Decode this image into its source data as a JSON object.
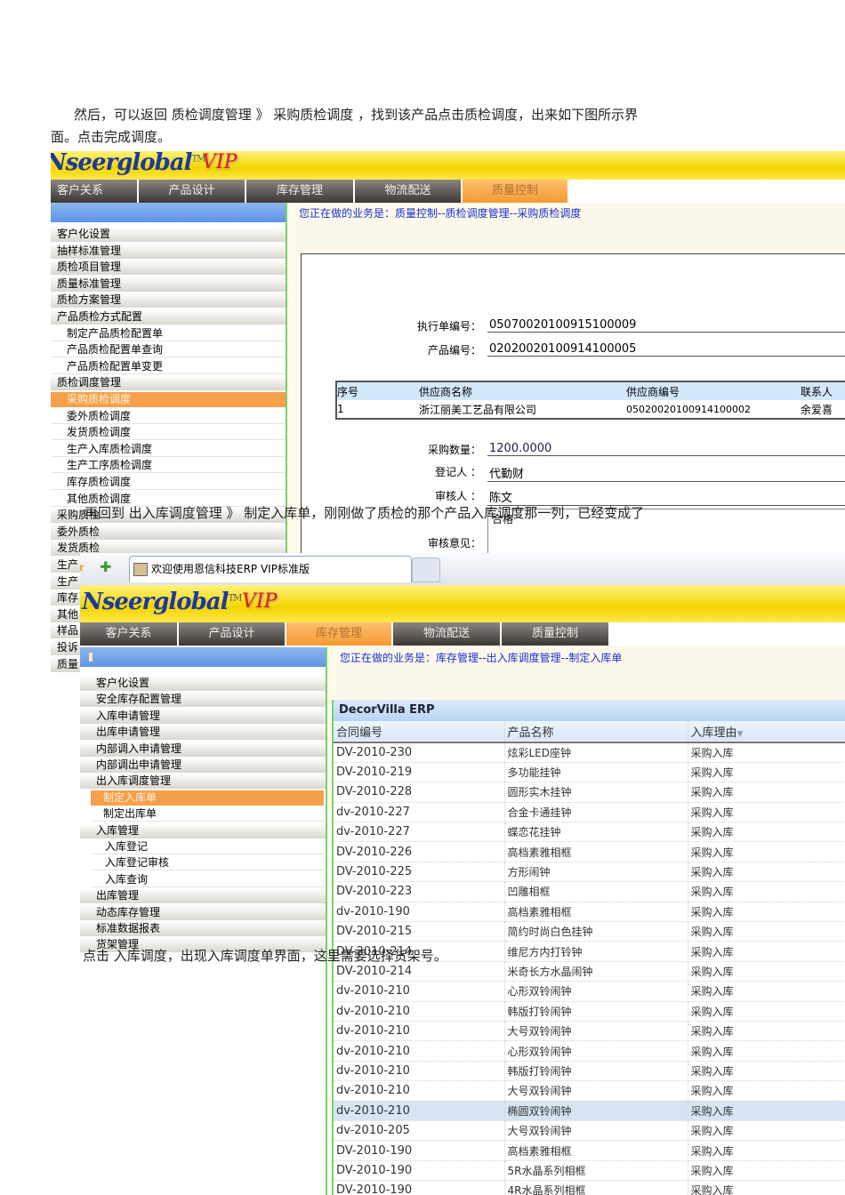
{
  "doc": {
    "para1_line1": "然后，可以返回 质检调度管理  》 采购质检调度 ，找到该产品点击质检调度，出来如下图所示界",
    "para1_line2": "面。点击完成调度。",
    "para2": "再回到  出入库调度管理 》 制定入库单，刚刚做了质检的那个产品入库调度那一列，已经变成了",
    "para3": "点击 入库调度，出现入库调度单界面，这里需要选择货架号。"
  },
  "shot1": {
    "logo": "Nseerglobal",
    "tm": "TM",
    "vip": "VIP",
    "nav": [
      "客户关系",
      "产品设计",
      "库存管理",
      "物流配送",
      "质量控制"
    ],
    "active_nav": 4,
    "crumb": "您正在做的业务是：质量控制--质检调度管理--采购质检调度",
    "sidebar": [
      {
        "label": "客户化设置",
        "type": "group"
      },
      {
        "label": "抽样标准管理",
        "type": "group"
      },
      {
        "label": "质检项目管理",
        "type": "group"
      },
      {
        "label": "质量标准管理",
        "type": "group"
      },
      {
        "label": "质检方案管理",
        "type": "group"
      },
      {
        "label": "产品质检方式配置",
        "type": "group"
      },
      {
        "label": "制定产品质检配置单",
        "type": "sub"
      },
      {
        "label": "产品质检配置单查询",
        "type": "sub"
      },
      {
        "label": "产品质检配置单变更",
        "type": "sub"
      },
      {
        "label": "质检调度管理",
        "type": "group"
      },
      {
        "label": "采购质检调度",
        "type": "sel"
      },
      {
        "label": "委外质检调度",
        "type": "sub"
      },
      {
        "label": "发货质检调度",
        "type": "sub"
      },
      {
        "label": "生产入库质检调度",
        "type": "sub"
      },
      {
        "label": "生产工序质检调度",
        "type": "sub"
      },
      {
        "label": "库存质检调度",
        "type": "sub"
      },
      {
        "label": "其他质检调度",
        "type": "sub"
      },
      {
        "label": "采购质检",
        "type": "group"
      },
      {
        "label": "委外质检",
        "type": "group"
      },
      {
        "label": "发货质检",
        "type": "group"
      },
      {
        "label": "生产",
        "type": "group"
      },
      {
        "label": "生产",
        "type": "group"
      },
      {
        "label": "库存",
        "type": "group"
      },
      {
        "label": "其他",
        "type": "group"
      },
      {
        "label": "样品",
        "type": "group"
      },
      {
        "label": "投诉",
        "type": "group"
      },
      {
        "label": "质量",
        "type": "group"
      }
    ],
    "form": {
      "exec_no_label": "执行单编号：",
      "exec_no": "05070020100915100009",
      "product_no_label": "产品编号：",
      "product_no": "02020020100914100005",
      "qty_label": "采购数量：",
      "qty": "1200.0000",
      "registrar_label": "登记人  ：",
      "registrar": "代勤财",
      "reviewer_label": "审核人  ：",
      "reviewer": "陈文",
      "opinion_label": "审核意见：",
      "opinion": "合格"
    },
    "supplier_table": {
      "headers": [
        "序号",
        "供应商名称",
        "供应商编号",
        "联系人"
      ],
      "rows": [
        [
          "1",
          "浙江丽美工艺品有限公司",
          "05020020100914100002",
          "余爱喜"
        ]
      ]
    }
  },
  "shot2": {
    "tab_title": "欢迎使用恩信科技ERP VIP标准版",
    "logo": "Nseerglobal",
    "tm": "TM",
    "vip": "VIP",
    "nav": [
      "客户关系",
      "产品设计",
      "库存管理",
      "物流配送",
      "质量控制"
    ],
    "active_nav": 2,
    "crumb": "您正在做的业务是：库存管理--出入库调度管理--制定入库单",
    "sidebar": [
      {
        "label": "客户化设置",
        "type": "group"
      },
      {
        "label": "安全库存配置管理",
        "type": "group"
      },
      {
        "label": "入库申请管理",
        "type": "group"
      },
      {
        "label": "出库申请管理",
        "type": "group"
      },
      {
        "label": "内部调入申请管理",
        "type": "group"
      },
      {
        "label": "内部调出申请管理",
        "type": "group"
      },
      {
        "label": "出入库调度管理",
        "type": "group"
      },
      {
        "label": "制定入库单",
        "type": "sel"
      },
      {
        "label": "制定出库单",
        "type": "sub"
      },
      {
        "label": "入库管理",
        "type": "group"
      },
      {
        "label": "入库登记",
        "type": "sub2"
      },
      {
        "label": "入库登记审核",
        "type": "sub2"
      },
      {
        "label": "入库查询",
        "type": "sub2"
      },
      {
        "label": "出库管理",
        "type": "group"
      },
      {
        "label": "动态库存管理",
        "type": "group"
      },
      {
        "label": "标准数据报表",
        "type": "group"
      },
      {
        "label": "货架管理",
        "type": "group"
      }
    ],
    "grid_title": "DecorVilla ERP",
    "grid_headers": [
      "合同编号",
      "产品名称",
      "入库理由"
    ],
    "highlight_row": 18,
    "grid_rows": [
      [
        "DV-2010-230",
        "炫彩LED座钟",
        "采购入库"
      ],
      [
        "DV-2010-219",
        "多功能挂钟",
        "采购入库"
      ],
      [
        "DV-2010-228",
        "圆形实木挂钟",
        "采购入库"
      ],
      [
        "dv-2010-227",
        "合金卡通挂钟",
        "采购入库"
      ],
      [
        "dv-2010-227",
        "蝶恋花挂钟",
        "采购入库"
      ],
      [
        "DV-2010-226",
        "高档素雅相框",
        "采购入库"
      ],
      [
        "DV-2010-225",
        "方形闹钟",
        "采购入库"
      ],
      [
        "DV-2010-223",
        "凹雕相框",
        "采购入库"
      ],
      [
        "dv-2010-190",
        "高档素雅相框",
        "采购入库"
      ],
      [
        "DV-2010-215",
        "简约时尚白色挂钟",
        "采购入库"
      ],
      [
        "DV-2010-214",
        "维尼方内打铃钟",
        "采购入库"
      ],
      [
        "DV-2010-214",
        "米奇长方水晶闹钟",
        "采购入库"
      ],
      [
        "dv-2010-210",
        "心形双铃闹钟",
        "采购入库"
      ],
      [
        "dv-2010-210",
        "韩版打铃闹钟",
        "采购入库"
      ],
      [
        "dv-2010-210",
        "大号双铃闹钟",
        "采购入库"
      ],
      [
        "dv-2010-210",
        "心形双铃闹钟",
        "采购入库"
      ],
      [
        "dv-2010-210",
        "韩版打铃闹钟",
        "采购入库"
      ],
      [
        "dv-2010-210",
        "大号双铃闹钟",
        "采购入库"
      ],
      [
        "dv-2010-210",
        "椭圆双铃闹钟",
        "采购入库"
      ],
      [
        "dv-2010-205",
        "大号双铃闹钟",
        "采购入库"
      ],
      [
        "DV-2010-190",
        "高档素雅相框",
        "采购入库"
      ],
      [
        "DV-2010-190",
        "5R水晶系列相框",
        "采购入库"
      ],
      [
        "DV-2010-190",
        "4R水晶系列相框",
        "采购入库"
      ]
    ]
  },
  "colors": {
    "accent_orange": "#f6a04c",
    "crumb_blue": "#1a2fd0",
    "banner_yellow": "#f3d400",
    "sidebar_head": "#6fa0e8"
  }
}
